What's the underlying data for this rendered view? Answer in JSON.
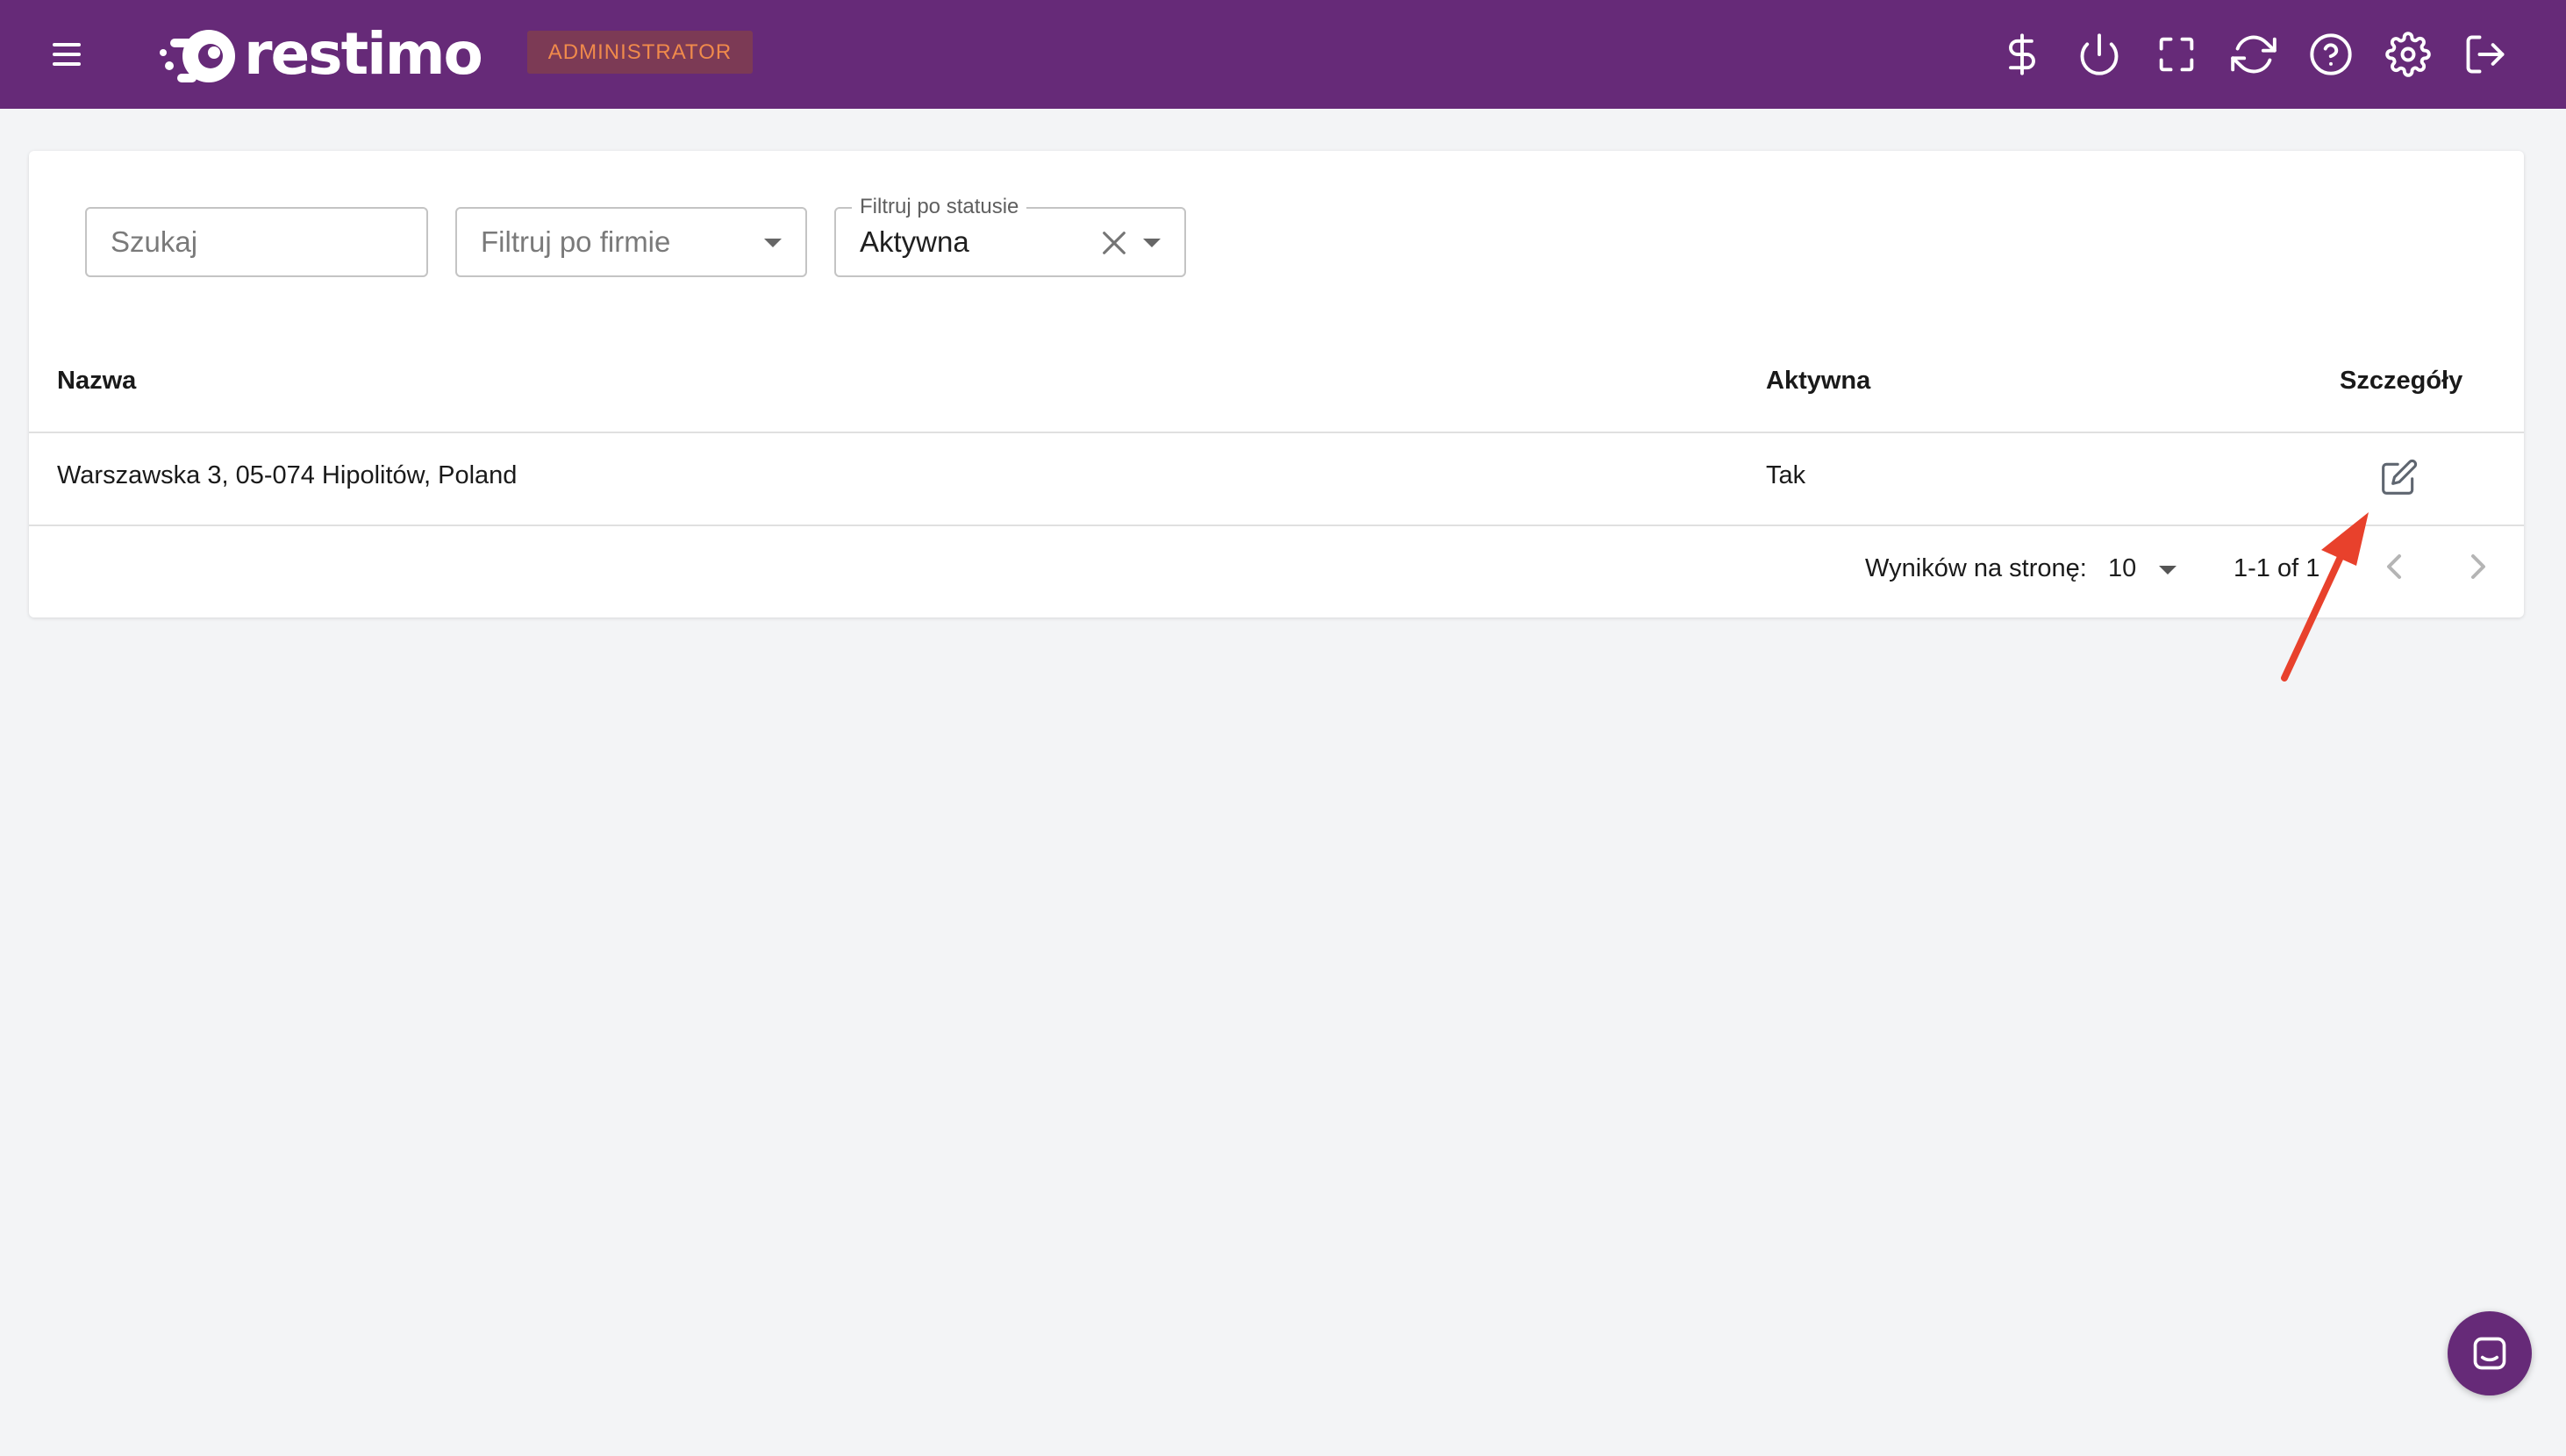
{
  "header": {
    "brand_name": "restimo",
    "role_badge": "ADMINISTRATOR",
    "background_color": "#662a78",
    "icons": [
      "menu-icon",
      "dollar-icon",
      "power-icon",
      "fullscreen-icon",
      "refresh-icon",
      "help-icon",
      "settings-icon",
      "logout-icon"
    ]
  },
  "filters": {
    "search_placeholder": "Szukaj",
    "company_filter_placeholder": "Filtruj po firmie",
    "status_filter_label": "Filtruj po statusie",
    "status_filter_value": "Aktywna"
  },
  "table": {
    "columns": [
      "Nazwa",
      "Aktywna",
      "Szczegóły"
    ],
    "rows": [
      {
        "name": "Warszawska 3, 05-074 Hipolitów, Poland",
        "active": "Tak"
      }
    ]
  },
  "pagination": {
    "rows_per_page_label": "Wyników na stronę:",
    "rows_per_page_value": "10",
    "range_text": "1-1 of 1"
  },
  "annotation": {
    "color": "#e8412c"
  },
  "chat": {
    "icon": "chat-icon"
  }
}
